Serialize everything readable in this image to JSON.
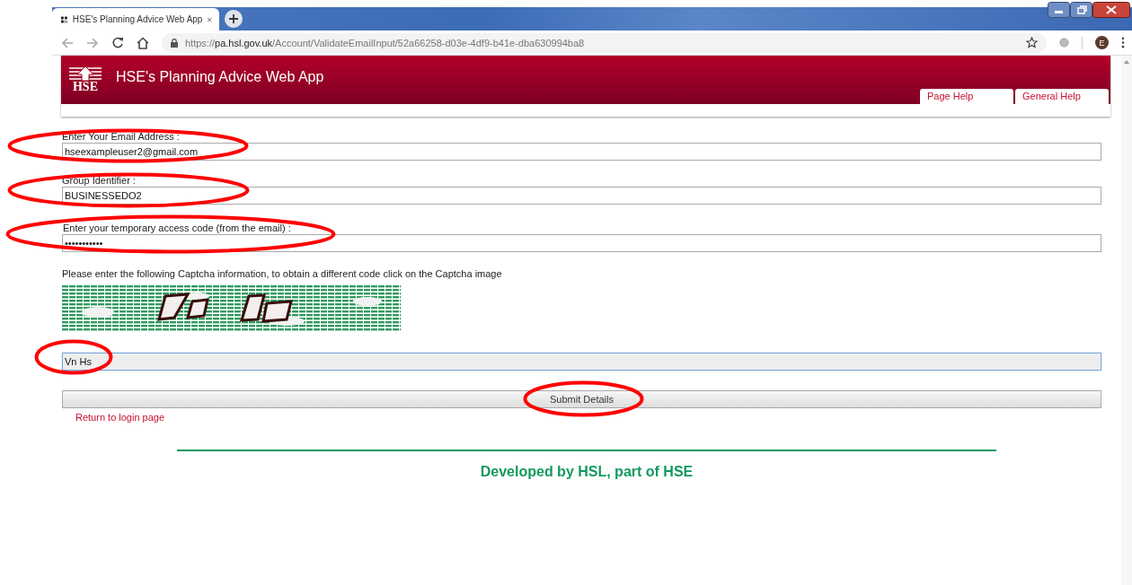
{
  "browser": {
    "tab": {
      "title": "HSE's Planning Advice Web App"
    },
    "address": {
      "scheme": "https://",
      "host": "pa.hsl.gov.uk",
      "path": "/Account/ValidateEmailInput/52a66258-d03e-4df9-b41e-dba630994ba8"
    },
    "profile": {
      "initial": "E"
    }
  },
  "header": {
    "logo": "HSE",
    "title": "HSE's Planning Advice Web App",
    "links": [
      {
        "label": "Page Help"
      },
      {
        "label": "General Help"
      }
    ]
  },
  "form": {
    "fields": [
      {
        "label": "Enter Your Email Address :",
        "value": "hseexampleuser2@gmail.com"
      },
      {
        "label": "Group Identifier :",
        "value": "BUSINESSEDO2"
      },
      {
        "label": "Enter your temporary access code (from the email) :",
        "value": "•••••••••••"
      }
    ],
    "captcha": {
      "instruction": "Please enter the following Captcha information, to obtain a different code click on the Captcha image",
      "answer": {
        "value": "Vn Hs",
        "focused": true
      }
    },
    "submit": "Submit Details",
    "link": "Return to login page"
  },
  "footer": "Developed by HSL, part of HSE"
}
